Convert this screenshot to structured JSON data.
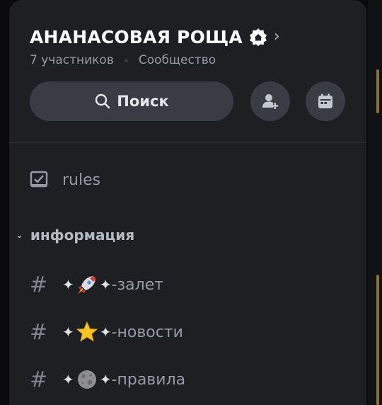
{
  "server": {
    "name": "АНАНАСОВАЯ РОЩА",
    "member_count": "7 участников",
    "type": "Сообщество",
    "badge_icon": "community-badge-icon",
    "chevron_icon": "chevron-right-icon"
  },
  "actions": {
    "search_label": "Поиск",
    "search_icon": "search-icon",
    "invite_icon": "add-member-icon",
    "events_icon": "calendar-icon"
  },
  "channels": {
    "rules": {
      "name": "rules",
      "icon": "rules-icon"
    },
    "category": {
      "name": "информация",
      "caret_icon": "chevron-down-icon"
    },
    "text_channels": [
      {
        "name": "-залет",
        "emoji": "rocket-emoji"
      },
      {
        "name": "-новости",
        "emoji": "star-emoji"
      },
      {
        "name": "-правила",
        "emoji": "moon-emoji"
      }
    ]
  },
  "colors": {
    "background": "#1e1f22",
    "button": "#3a3c43",
    "muted_text": "#949ba4",
    "accent_scroll": "#8a6f3a"
  }
}
